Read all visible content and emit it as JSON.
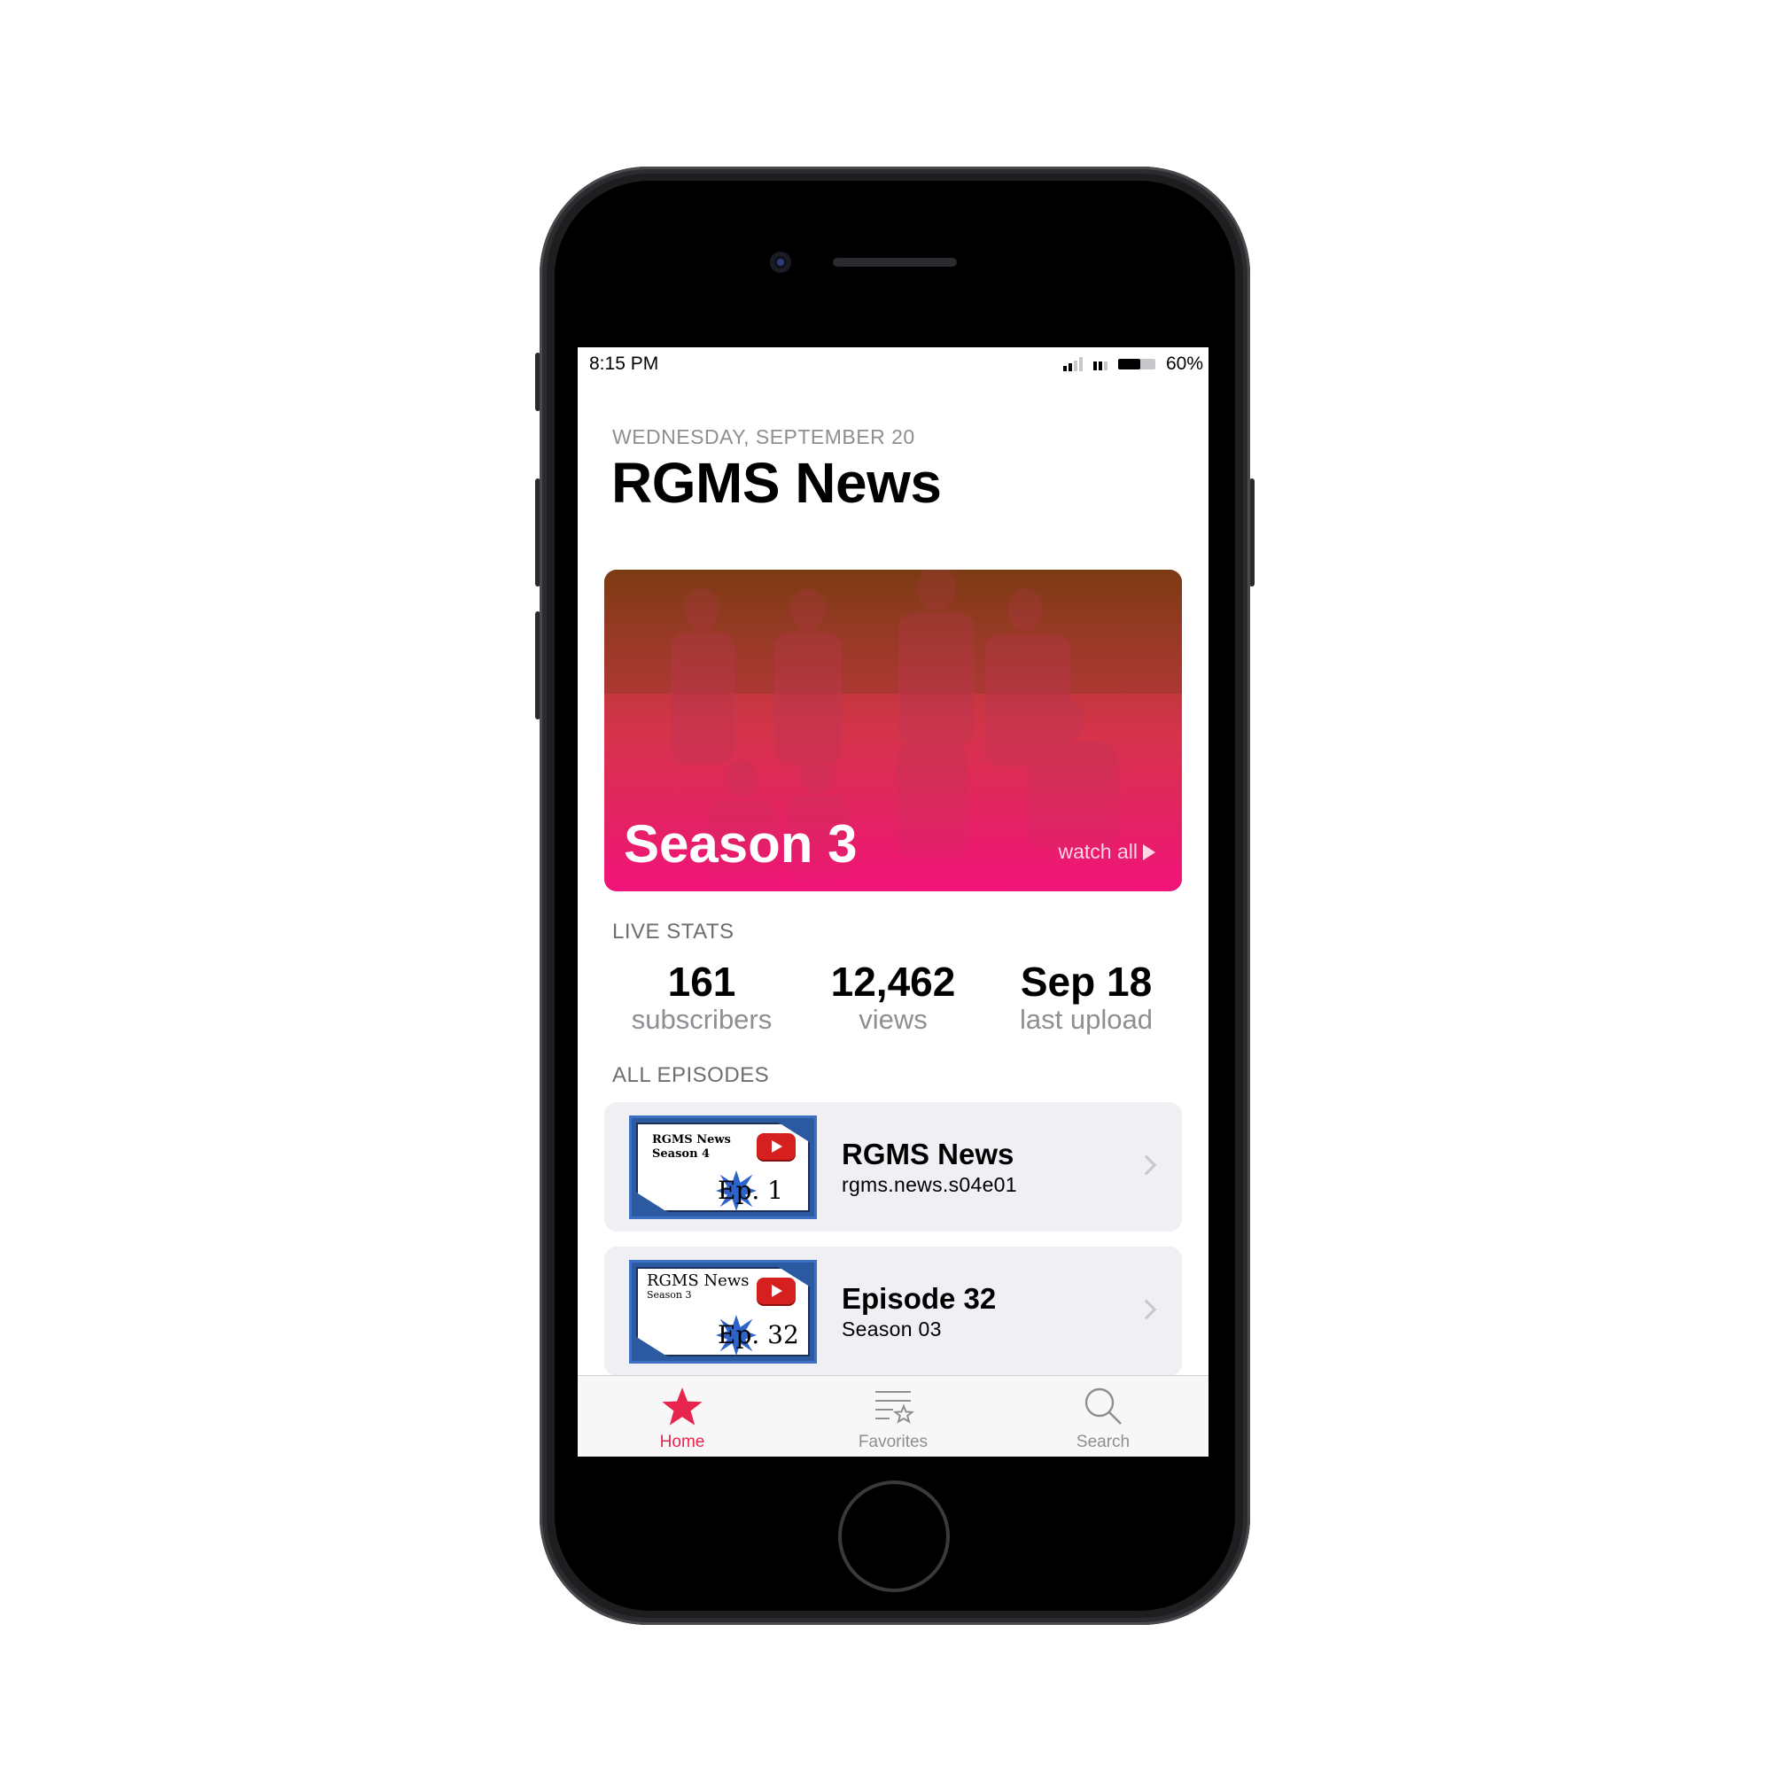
{
  "status_bar": {
    "time": "8:15 PM",
    "battery_percent_label": "60%",
    "battery_level": 0.6,
    "signal_bars": 2,
    "signal_bars_total": 4
  },
  "header": {
    "date": "WEDNESDAY, SEPTEMBER 20",
    "title": "RGMS News"
  },
  "hero": {
    "title": "Season 3",
    "watch_all": "watch all",
    "gradient_top": "#9c3a1a",
    "gradient_bottom": "#f2137a"
  },
  "live_stats": {
    "label": "LIVE STATS",
    "items": [
      {
        "value": "161",
        "caption": "subscribers"
      },
      {
        "value": "12,462",
        "caption": "views"
      },
      {
        "value": "Sep 18",
        "caption": "last upload"
      }
    ]
  },
  "episodes": {
    "label": "ALL EPISODES",
    "items": [
      {
        "title": "RGMS News",
        "subtitle": "rgms.news.s04e01",
        "thumb_title": "RGMS News",
        "thumb_season": "Season 4",
        "thumb_ep": "Ep. 1"
      },
      {
        "title": "Episode 32",
        "subtitle": "Season 03",
        "thumb_title": "RGMS News",
        "thumb_season": "Season 3",
        "thumb_ep": "Ep. 32"
      }
    ]
  },
  "tab_bar": {
    "items": [
      {
        "label": "Home",
        "icon": "star-icon",
        "active": true
      },
      {
        "label": "Favorites",
        "icon": "favorites-list-icon",
        "active": false
      },
      {
        "label": "Search",
        "icon": "search-icon",
        "active": false
      }
    ],
    "accent": "#e8254f",
    "inactive": "#8e8e93"
  }
}
